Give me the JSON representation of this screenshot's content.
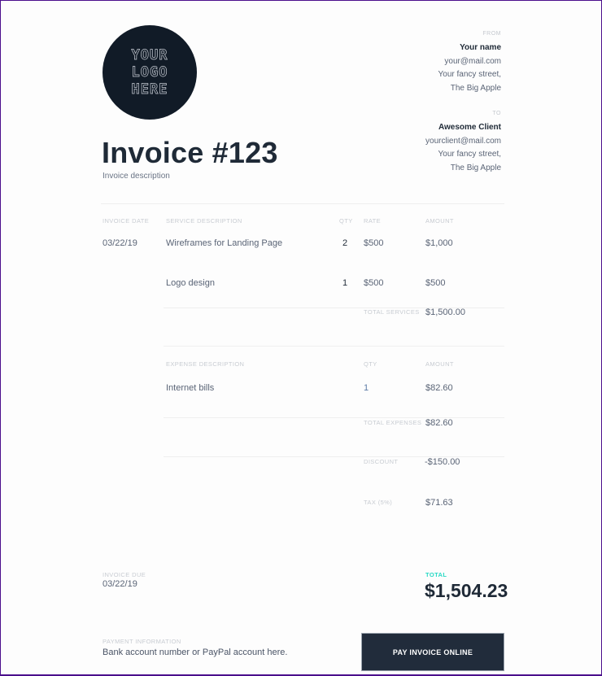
{
  "logo": {
    "lines": [
      "YOUR",
      "LOGO",
      "HERE"
    ]
  },
  "invoice": {
    "title": "Invoice #123",
    "description": "Invoice description"
  },
  "from": {
    "label": "FROM",
    "name": "Your name",
    "email": "your@mail.com",
    "street": "Your fancy street,",
    "city": "The Big Apple"
  },
  "to": {
    "label": "TO",
    "name": "Awesome Client",
    "email": "yourclient@mail.com",
    "street": "Your fancy street,",
    "city": "The Big Apple"
  },
  "services": {
    "headers": {
      "date": "INVOICE DATE",
      "description": "SERVICE DESCRIPTION",
      "qty": "QTY",
      "rate": "RATE",
      "amount": "AMOUNT"
    },
    "date": "03/22/19",
    "rows": [
      {
        "description": "Wireframes for Landing Page",
        "qty": "2",
        "rate": "$500",
        "amount": "$1,000"
      },
      {
        "description": "Logo design",
        "qty": "1",
        "rate": "$500",
        "amount": "$500"
      }
    ],
    "total_label": "TOTAL SERVICES",
    "total_value": "$1,500.00"
  },
  "expenses": {
    "headers": {
      "description": "EXPENSE DESCRIPTION",
      "qty": "QTY",
      "amount": "AMOUNT"
    },
    "rows": [
      {
        "description": "Internet bills",
        "qty": "1",
        "amount": "$82.60"
      }
    ],
    "total_label": "TOTAL EXPENSES",
    "total_value": "$82.60"
  },
  "discount": {
    "label": "DISCOUNT",
    "value": "-$150.00"
  },
  "tax": {
    "label": "TAX (5%)",
    "value": "$71.63"
  },
  "due": {
    "label": "INVOICE DUE",
    "value": "03/22/19"
  },
  "total": {
    "label": "TOTAL",
    "value": "$1,504.23",
    "accent": "#27d9c4"
  },
  "payment": {
    "label": "PAYMENT INFORMATION",
    "text": "Bank account number or PayPal account here.",
    "button": "PAY INVOICE ONLINE"
  }
}
